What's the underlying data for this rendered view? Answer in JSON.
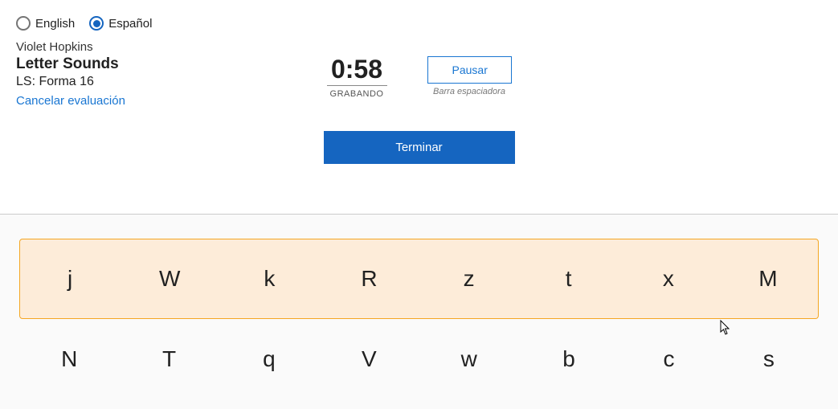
{
  "language": {
    "options": [
      {
        "label": "English",
        "selected": false
      },
      {
        "label": "Español",
        "selected": true
      }
    ]
  },
  "student_name": "Violet Hopkins",
  "assessment_title": "Letter Sounds",
  "form_label": "LS: Forma 16",
  "cancel_label": "Cancelar evaluación",
  "timer": {
    "value": "0:58",
    "status": "GRABANDO"
  },
  "pause": {
    "button_label": "Pausar",
    "hint": "Barra espaciadora"
  },
  "finish_label": "Terminar",
  "letter_grid": {
    "rows": [
      {
        "highlighted": true,
        "letters": [
          "j",
          "W",
          "k",
          "R",
          "z",
          "t",
          "x",
          "M"
        ]
      },
      {
        "highlighted": false,
        "letters": [
          "N",
          "T",
          "q",
          "V",
          "w",
          "b",
          "c",
          "s"
        ]
      }
    ]
  }
}
